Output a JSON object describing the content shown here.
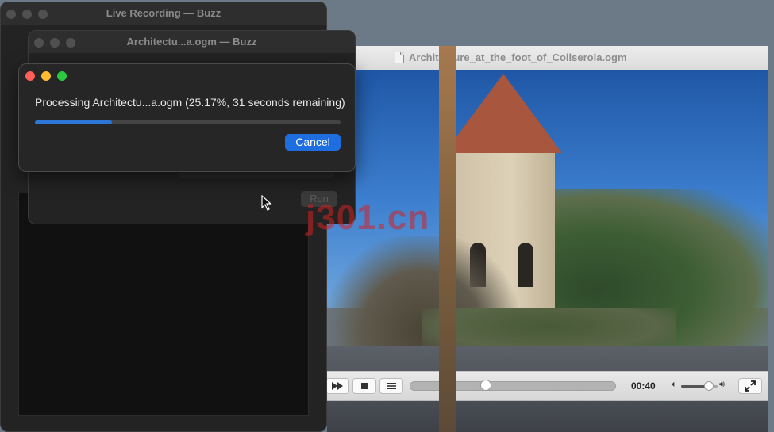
{
  "video_window": {
    "title": "Architecture_at_the_foot_of_Collserola.ogm",
    "controls": {
      "time": "00:40",
      "seek_progress": 0.37,
      "volume_level": 0.75,
      "fast_forward_icon": "fast-forward-icon",
      "stop_icon": "stop-icon",
      "playlist_icon": "playlist-icon",
      "fullscreen_icon": "fullscreen-icon"
    }
  },
  "live_recording_window": {
    "title": "Live Recording — Buzz"
  },
  "file_window": {
    "title": "Architectu...a.ogm — Buzz",
    "run_label": "Run"
  },
  "progress_dialog": {
    "status": "Processing Architectu...a.ogm (25.17%, 31 seconds remaining)",
    "progress": 0.2517,
    "cancel_label": "Cancel"
  },
  "watermark": "j301.cn",
  "colors": {
    "accent": "#1f6ee0",
    "progress": "#2c76d8",
    "close": "#fe5f57",
    "minimize": "#febc2e",
    "zoom": "#28c840"
  }
}
